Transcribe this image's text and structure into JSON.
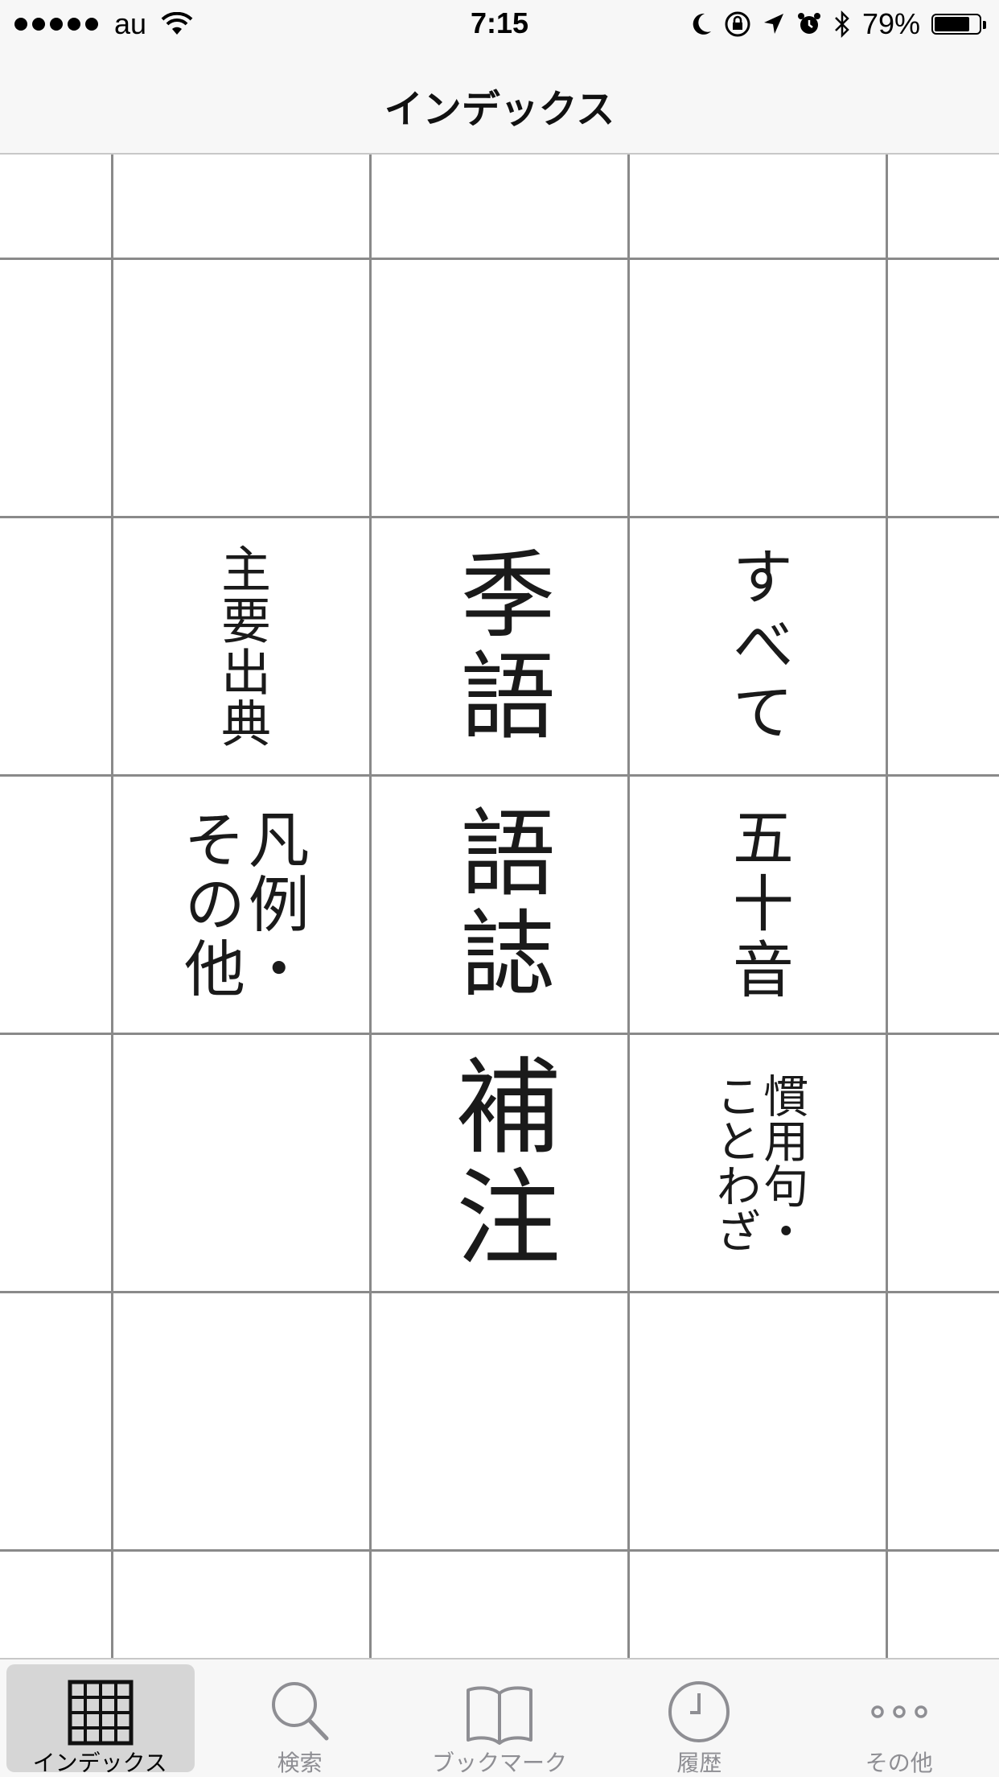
{
  "status_bar": {
    "carrier": "au",
    "time": "7:15",
    "battery_percent": "79%",
    "battery_level": 0.79
  },
  "nav": {
    "title": "インデックス"
  },
  "index": {
    "shuyou_shutten": "主要出典",
    "kigo": "季語",
    "subete": "すべて",
    "hanrei_line1": "凡例・",
    "hanrei_line2": "その他",
    "goshi": "語誌",
    "gojuuon": "五十音",
    "hochuu": "補注",
    "kanyouku_line1": "慣用句・",
    "kanyouku_line2": "ことわざ"
  },
  "tabbar": {
    "index": "インデックス",
    "search": "検索",
    "bookmark": "ブックマーク",
    "history": "履歴",
    "more": "その他"
  },
  "icons": {
    "tab_index": "grid-icon",
    "tab_search": "magnifier-icon",
    "tab_bookmark": "open-book-icon",
    "tab_history": "clock-icon",
    "tab_more": "ellipsis-icon"
  },
  "colors": {
    "grid_line": "#8a8a8a",
    "bar_bg": "#f7f7f7",
    "inactive_tab": "#8e8e93",
    "active_tab_bg": "#d6d6d6"
  }
}
